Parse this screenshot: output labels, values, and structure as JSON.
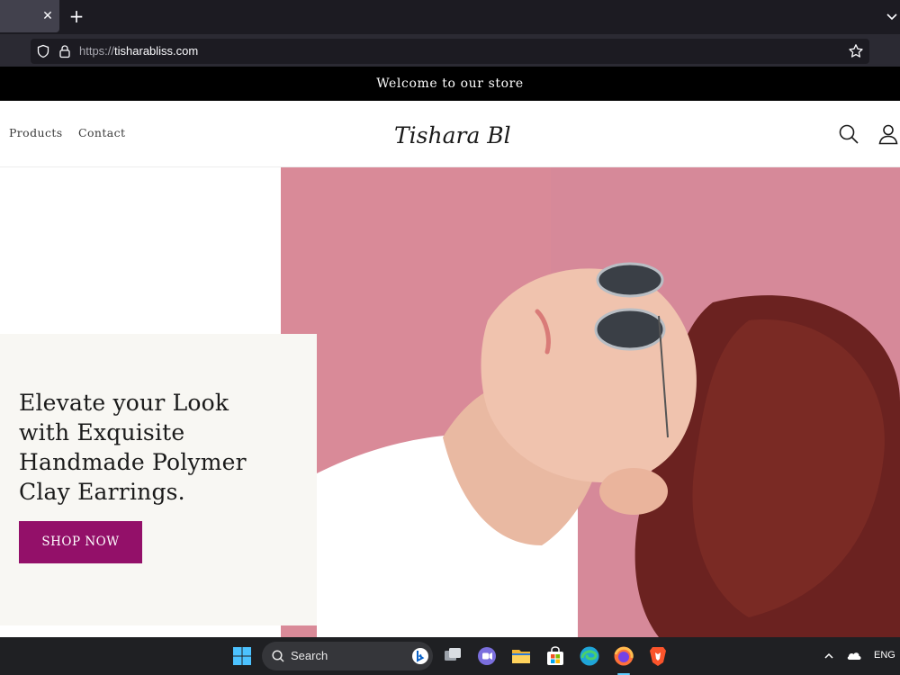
{
  "browser": {
    "url_scheme": "https://",
    "url_host": "tisharabliss.com"
  },
  "announcement": {
    "text": "Welcome to our store"
  },
  "header": {
    "nav": [
      {
        "label": "Products"
      },
      {
        "label": "Contact"
      }
    ],
    "logo_text": "Tishara Bliss"
  },
  "hero": {
    "heading_lines": [
      "Elevate your Look",
      "with Exquisite",
      "Handmade Polymer",
      "Clay Earrings."
    ],
    "cta_label": "SHOP NOW",
    "cta_color": "#931069"
  },
  "taskbar": {
    "search_label": "Search",
    "language": "ENG",
    "icons": [
      "windows-start-icon",
      "search-icon",
      "bing-icon",
      "task-view-icon",
      "chat-icon",
      "file-explorer-icon",
      "store-icon",
      "edge-icon",
      "firefox-icon",
      "brave-icon"
    ]
  }
}
